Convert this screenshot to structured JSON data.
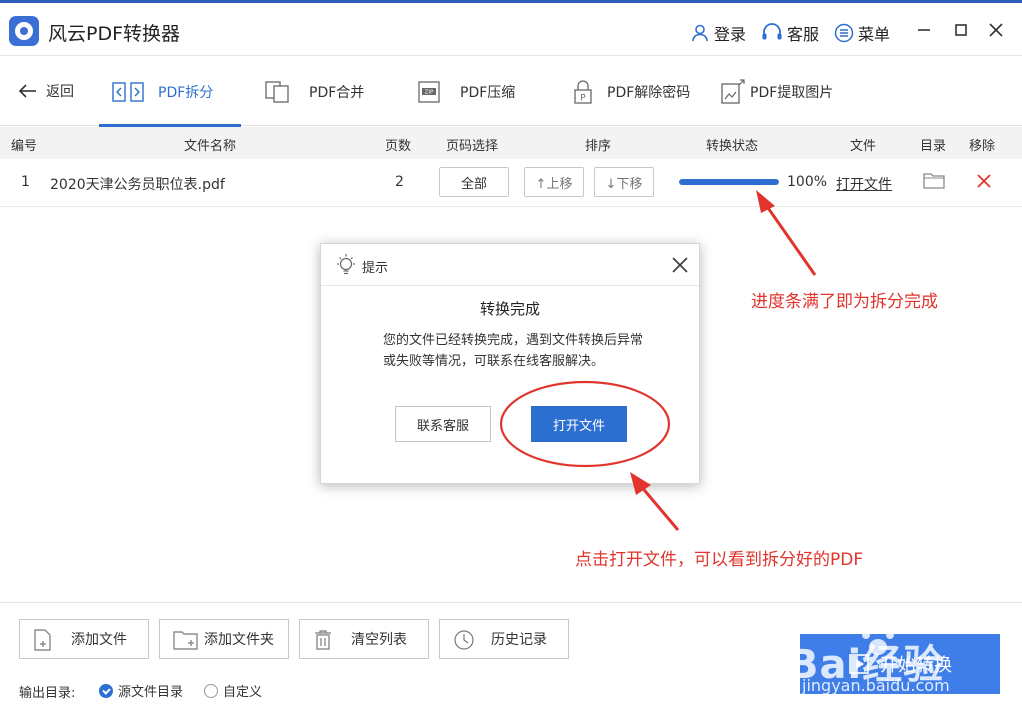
{
  "app": {
    "title": "风云PDF转换器"
  },
  "titlebar": {
    "login": "登录",
    "service": "客服",
    "menu": "菜单"
  },
  "toolbar": {
    "back": "返回",
    "tabs": [
      {
        "label": "PDF拆分",
        "icon": "split-icon",
        "active": true
      },
      {
        "label": "PDF合并",
        "icon": "merge-icon",
        "active": false
      },
      {
        "label": "PDF压缩",
        "icon": "zip-icon",
        "active": false
      },
      {
        "label": "PDF解除密码",
        "icon": "unlock-icon",
        "active": false
      },
      {
        "label": "PDF提取图片",
        "icon": "image-extract-icon",
        "active": false
      }
    ]
  },
  "table": {
    "headers": {
      "no": "编号",
      "name": "文件名称",
      "pages": "页数",
      "range": "页码选择",
      "order": "排序",
      "status": "转换状态",
      "file": "文件",
      "dir": "目录",
      "remove": "移除"
    },
    "rows": [
      {
        "no": "1",
        "name": "2020天津公务员职位表.pdf",
        "pages": "2",
        "range": "全部",
        "up": "↑上移",
        "down": "↓下移",
        "progress": 1.0,
        "percent": "100%",
        "open": "打开文件"
      }
    ]
  },
  "dialog": {
    "title": "提示",
    "heading": "转换完成",
    "message": "您的文件已经转换完成，遇到文件转换后异常或失败等情况，可联系在线客服解决。",
    "contact": "联系客服",
    "open": "打开文件"
  },
  "annotations": {
    "progress_note": "进度条满了即为拆分完成",
    "open_note": "点击打开文件，可以看到拆分好的PDF"
  },
  "bottom": {
    "add_file": "添加文件",
    "add_folder": "添加文件夹",
    "clear": "清空列表",
    "history": "历史记录",
    "output_label": "输出目录:",
    "source_dir": "源文件目录",
    "custom": "自定义",
    "start": "开始转换"
  },
  "watermark": {
    "logo": "Bai经验",
    "sub": "jingyan.baidu.com"
  },
  "colors": {
    "accent": "#2d6fd1",
    "start_button": "#3f7ee8",
    "annotation": "#e0342c"
  }
}
